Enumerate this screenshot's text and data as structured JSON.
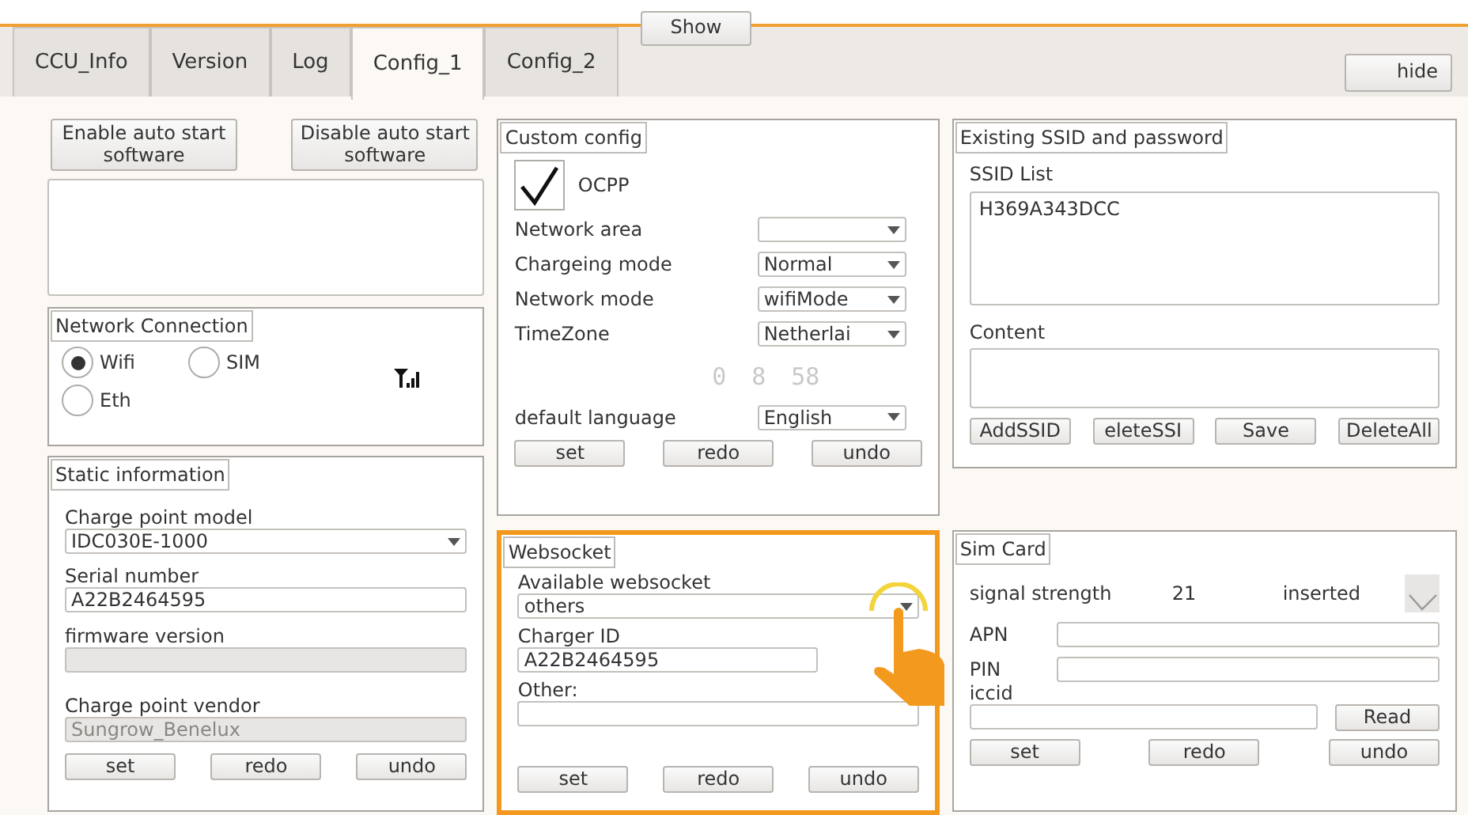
{
  "tabs": [
    {
      "label": "CCU_Info",
      "selected": false
    },
    {
      "label": "Version",
      "selected": false
    },
    {
      "label": "Log",
      "selected": false
    },
    {
      "label": "Config_1",
      "selected": true
    },
    {
      "label": "Config_2",
      "selected": false
    }
  ],
  "show_button": "Show",
  "hide_button": "hide",
  "auto_start_buttons": [
    "Enable auto start software",
    "Disable auto start software"
  ],
  "network_connection": {
    "title": "Network Connection",
    "options": [
      {
        "label": "Wifi",
        "selected": true
      },
      {
        "label": "SIM",
        "selected": false
      },
      {
        "label": "Eth",
        "selected": false
      }
    ]
  },
  "static_information": {
    "title": "Static information",
    "fields": [
      {
        "label": "Charge point model",
        "kind": "select",
        "value": "IDC030E-1000"
      },
      {
        "label": "Serial number",
        "kind": "text",
        "value": "A22B2464595"
      },
      {
        "label": "firmware version",
        "kind": "disabled"
      },
      {
        "label": "Charge point vendor",
        "kind": "disabled",
        "value": "Sungrow_Benelux"
      }
    ],
    "buttons": [
      "set",
      "redo",
      "undo"
    ]
  },
  "custom_config": {
    "title": "Custom config",
    "ocpp": {
      "label": "OCPP",
      "checked": true
    },
    "settings": [
      {
        "label": "Network area"
      },
      {
        "label": "Chargeing mode",
        "value": "Normal"
      },
      {
        "label": "Network mode",
        "value": "wifiMode"
      },
      {
        "label": "TimeZone",
        "value": "Netherlai"
      }
    ],
    "clock": [
      "0",
      "8",
      "58"
    ],
    "language": {
      "label": "default language",
      "value": "English"
    },
    "buttons": [
      "set",
      "redo",
      "undo"
    ]
  },
  "websocket": {
    "title": "Websocket",
    "highlighted": true,
    "available_label": "Available websocket",
    "available_value": "others",
    "charger_id_label": "Charger ID",
    "charger_id": "A22B2464595",
    "other_label": "Other:",
    "buttons": [
      "set",
      "redo",
      "undo"
    ]
  },
  "ssid": {
    "title": "Existing SSID and password",
    "list_label": "SSID List",
    "items": [
      "H369A343DCC"
    ],
    "content_label": "Content",
    "buttons": [
      "AddSSID",
      "eleteSSI",
      "Save",
      "DeleteAll"
    ]
  },
  "sim_card": {
    "title": "Sim Card",
    "signal_label": "signal strength",
    "signal_value": "21",
    "inserted_label": "inserted",
    "inserted": true,
    "apn_label": "APN",
    "pin_label": "PIN",
    "iccid_label": "iccid",
    "read_button": "Read",
    "buttons": [
      "set",
      "redo",
      "undo"
    ]
  }
}
